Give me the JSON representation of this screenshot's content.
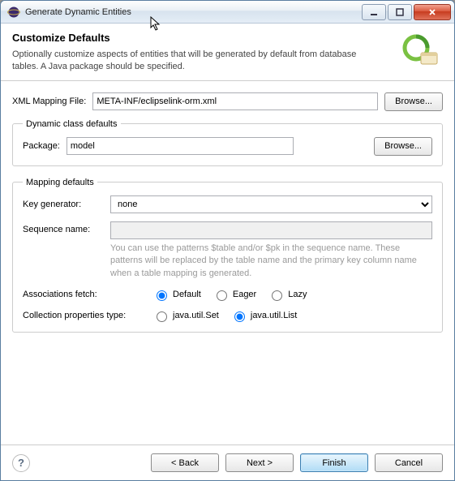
{
  "window": {
    "title": "Generate Dynamic Entities"
  },
  "header": {
    "title": "Customize Defaults",
    "description": "Optionally customize aspects of entities that will be generated by default from database tables. A Java package should be specified."
  },
  "xml_mapping": {
    "label": "XML Mapping File:",
    "value": "META-INF/eclipselink-orm.xml",
    "browse": "Browse..."
  },
  "dynamic_defaults": {
    "legend": "Dynamic class defaults",
    "package_label": "Package:",
    "package_value": "model",
    "browse": "Browse..."
  },
  "mapping_defaults": {
    "legend": "Mapping defaults",
    "key_generator_label": "Key generator:",
    "key_generator_value": "none",
    "sequence_name_label": "Sequence name:",
    "sequence_name_value": "",
    "sequence_hint": "You can use the patterns $table and/or $pk in the sequence name. These patterns will be replaced by the table name and the primary key column name when a table mapping is generated.",
    "assoc_fetch_label": "Associations fetch:",
    "assoc_fetch_options": [
      "Default",
      "Eager",
      "Lazy"
    ],
    "assoc_fetch_selected": "Default",
    "coll_type_label": "Collection properties type:",
    "coll_type_options": [
      "java.util.Set",
      "java.util.List"
    ],
    "coll_type_selected": "java.util.List"
  },
  "buttons": {
    "back": "< Back",
    "next": "Next >",
    "finish": "Finish",
    "cancel": "Cancel"
  }
}
